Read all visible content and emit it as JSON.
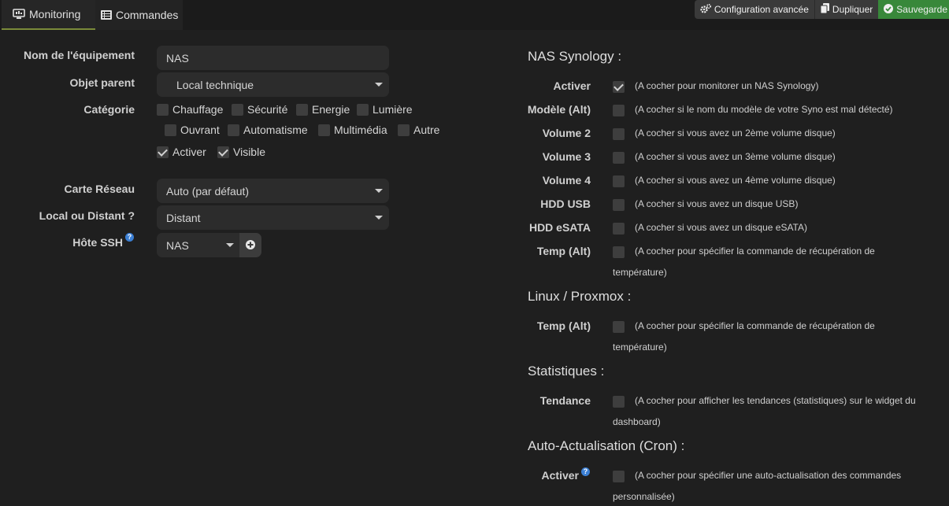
{
  "tabs": {
    "monitoring": "Monitoring",
    "commandes": "Commandes"
  },
  "actions": {
    "config": "Configuration avancée",
    "duplicate": "Dupliquer",
    "save": "Sauvegarde"
  },
  "form": {
    "name_label": "Nom de l'équipement",
    "name_value": "NAS",
    "parent_label": "Objet parent",
    "parent_value": "Local technique",
    "category_label": "Catégorie",
    "categories": [
      "Chauffage",
      "Sécurité",
      "Energie",
      "Lumière",
      "Ouvrant",
      "Automatisme",
      "Multimédia",
      "Autre"
    ],
    "activer": "Activer",
    "visible": "Visible",
    "network_label": "Carte Réseau",
    "network_value": "Auto (par défaut)",
    "local_label": "Local ou Distant ?",
    "local_value": "Distant",
    "ssh_label": "Hôte SSH",
    "ssh_value": "NAS"
  },
  "right": {
    "nas_title": "NAS Synology :",
    "nas_rows": [
      {
        "label": "Activer",
        "hint": "(A cocher pour monitorer un NAS Synology)",
        "checked": true
      },
      {
        "label": "Modèle (Alt)",
        "hint": "(A cocher si le nom du modèle de votre Syno est mal détecté)",
        "checked": false
      },
      {
        "label": "Volume 2",
        "hint": "(A cocher si vous avez un 2ème volume disque)",
        "checked": false
      },
      {
        "label": "Volume 3",
        "hint": "(A cocher si vous avez un 3ème volume disque)",
        "checked": false
      },
      {
        "label": "Volume 4",
        "hint": "(A cocher si vous avez un 4ème volume disque)",
        "checked": false
      },
      {
        "label": "HDD USB",
        "hint": "(A cocher si vous avez un disque USB)",
        "checked": false
      },
      {
        "label": "HDD eSATA",
        "hint": "(A cocher si vous avez un disque eSATA)",
        "checked": false
      },
      {
        "label": "Temp (Alt)",
        "hint": "(A cocher pour spécifier la commande de récupération de",
        "hint2": "température)",
        "checked": false
      }
    ],
    "linux_title": "Linux / Proxmox :",
    "linux_temp_label": "Temp (Alt)",
    "linux_temp_hint": "(A cocher pour spécifier la commande de récupération de",
    "linux_temp_hint2": "température)",
    "stats_title": "Statistiques :",
    "tendance_label": "Tendance",
    "tendance_hint": "(A cocher pour afficher les tendances (statistiques) sur le widget du",
    "tendance_hint2": "dashboard)",
    "cron_title": "Auto-Actualisation (Cron) :",
    "cron_label": "Activer",
    "cron_hint": "(A cocher pour spécifier une auto-actualisation des commandes",
    "cron_hint2": "personnalisée)"
  }
}
